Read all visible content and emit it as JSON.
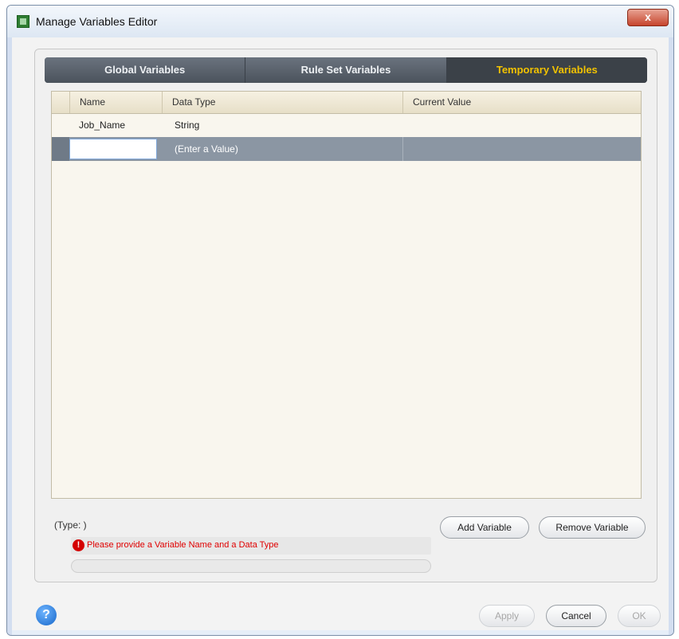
{
  "window": {
    "title": "Manage Variables Editor",
    "close_label": "x"
  },
  "tabs": [
    {
      "label": "Global Variables",
      "active": false
    },
    {
      "label": "Rule Set Variables",
      "active": false
    },
    {
      "label": "Temporary Variables",
      "active": true
    }
  ],
  "table": {
    "columns": [
      "Name",
      "Data Type",
      "Current Value"
    ],
    "rows": [
      {
        "name": "Job_Name",
        "data_type": "String",
        "current_value": ""
      }
    ],
    "editing_row": {
      "name_value": "",
      "data_type_placeholder": "(Enter a Value)",
      "current_value": ""
    }
  },
  "status": {
    "type_text": "(Type: )"
  },
  "buttons": {
    "add_variable": "Add Variable",
    "remove_variable": "Remove Variable",
    "apply": "Apply",
    "cancel": "Cancel",
    "ok": "OK"
  },
  "error": {
    "icon": "!",
    "message": "Please provide a Variable Name and a Data Type"
  },
  "help": {
    "icon": "?"
  },
  "colors": {
    "active_tab_text": "#f2c200",
    "selected_row": "#8b96a3",
    "error_text": "#e00000",
    "close_button": "#c6452d"
  }
}
